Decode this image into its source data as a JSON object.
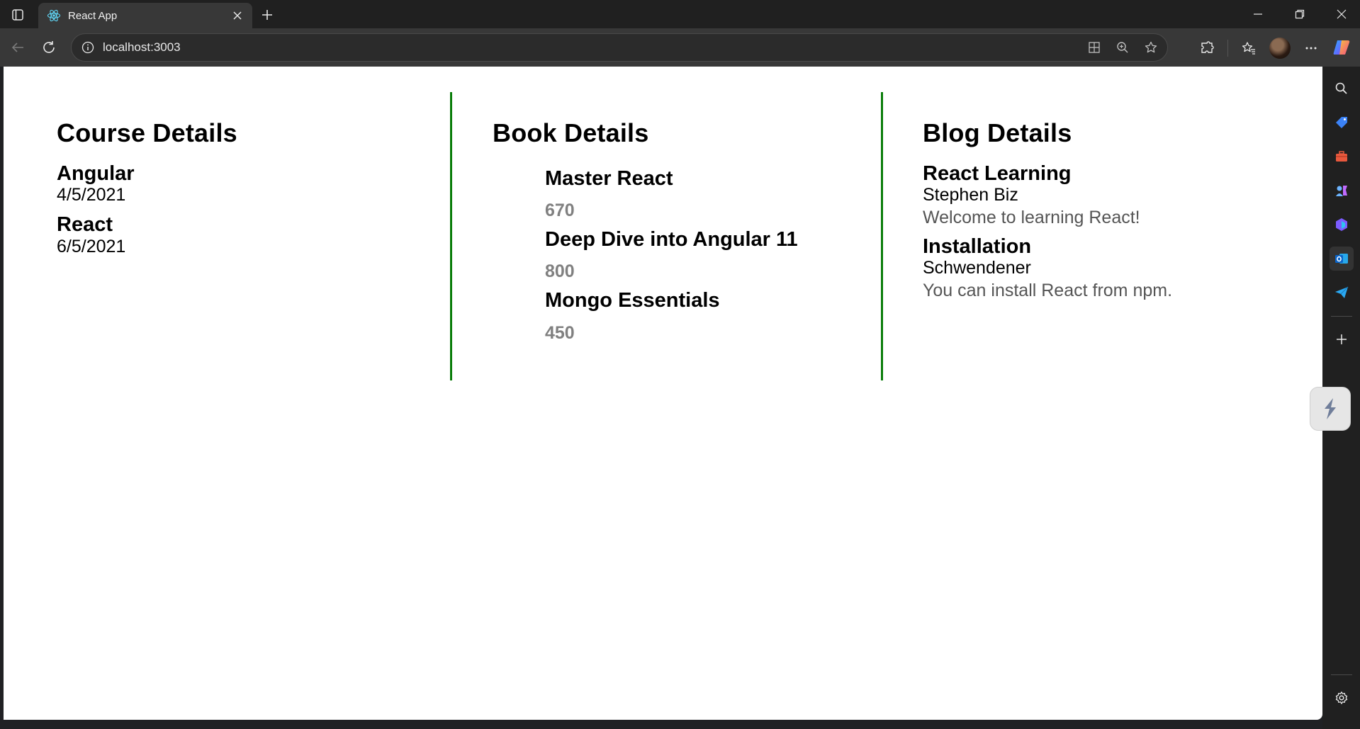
{
  "browser": {
    "tab": {
      "title": "React App"
    },
    "address": {
      "url": "localhost:3003"
    }
  },
  "page": {
    "courses": {
      "heading": "Course Details",
      "items": [
        {
          "name": "Angular",
          "date": "4/5/2021"
        },
        {
          "name": "React",
          "date": "6/5/2021"
        }
      ]
    },
    "books": {
      "heading": "Book Details",
      "items": [
        {
          "name": "Master React",
          "price": "670"
        },
        {
          "name": "Deep Dive into Angular 11",
          "price": "800"
        },
        {
          "name": "Mongo Essentials",
          "price": "450"
        }
      ]
    },
    "blogs": {
      "heading": "Blog Details",
      "items": [
        {
          "title": "React Learning",
          "author": "Stephen Biz",
          "body": "Welcome to learning React!"
        },
        {
          "title": "Installation",
          "author": "Schwendener",
          "body": "You can install React from npm."
        }
      ]
    }
  },
  "colors": {
    "divider": "#0a7d0a",
    "price": "#808080",
    "blog_body": "#555555"
  },
  "icons": {
    "tab_favicon": "react-logo-icon",
    "sidebar": [
      "search-icon",
      "shopping-tag-icon",
      "toolbox-icon",
      "games-icon",
      "microsoft-365-icon",
      "outlook-icon",
      "telegram-icon",
      "add-icon",
      "settings-icon"
    ]
  }
}
